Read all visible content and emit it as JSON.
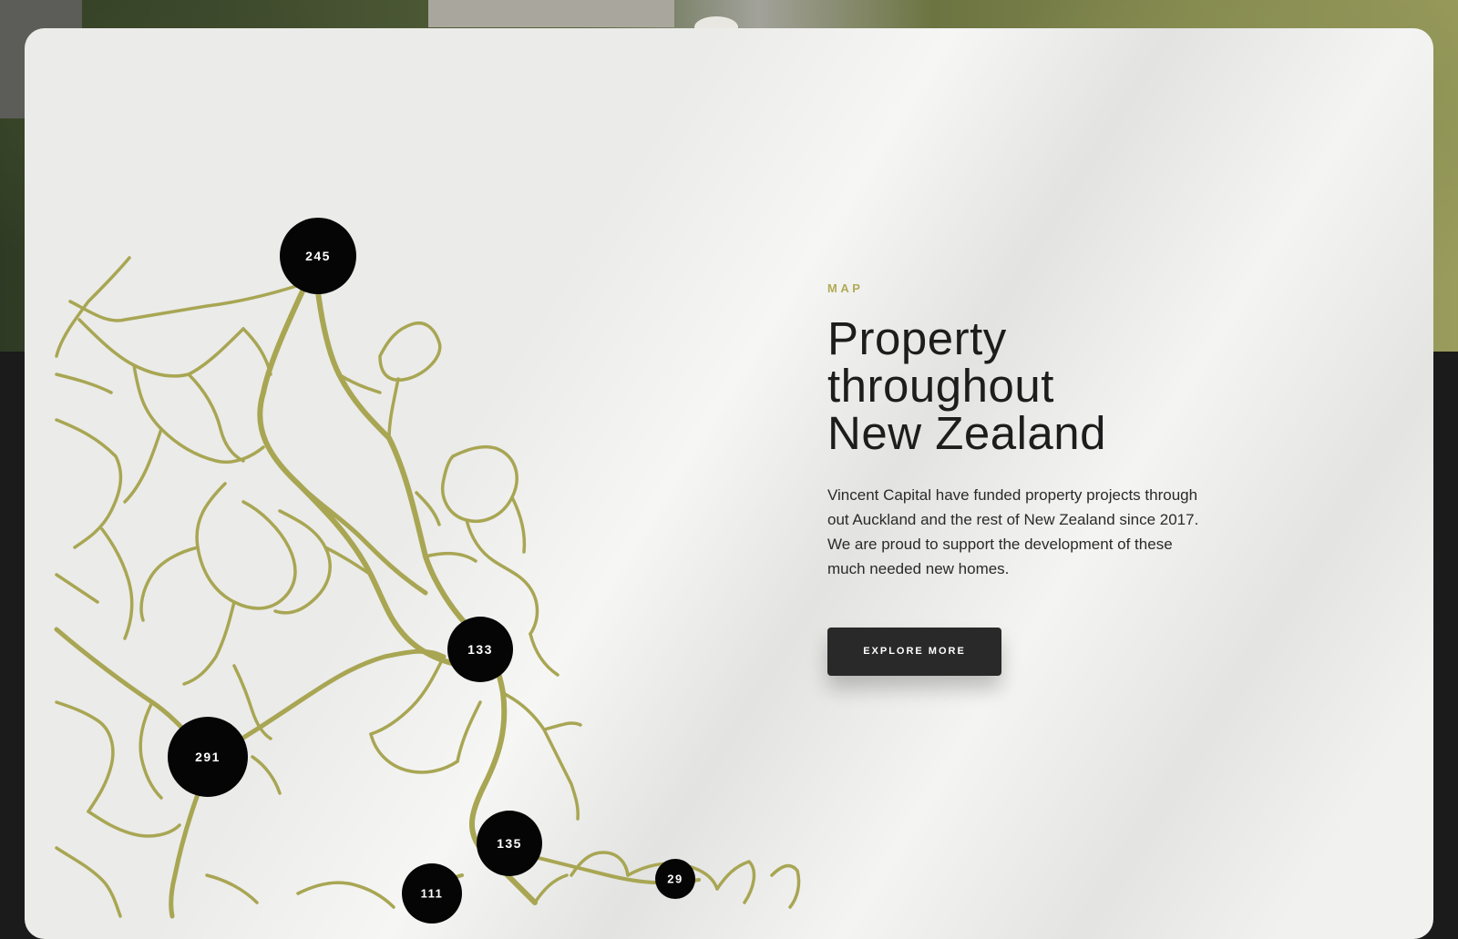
{
  "section": {
    "eyebrow": "MAP",
    "title_lines": [
      "Property",
      "throughout",
      "New Zealand"
    ],
    "description": "Vincent Capital have funded property projects through out Auckland and the rest of New Zealand since 2017. We are proud to support the development of these much needed new homes.",
    "cta_label": "EXPLORE MORE"
  },
  "map": {
    "road_color": "#a8a653",
    "marker_color": "#050505",
    "markers": [
      "245",
      "133",
      "291",
      "135",
      "111",
      "29"
    ]
  }
}
